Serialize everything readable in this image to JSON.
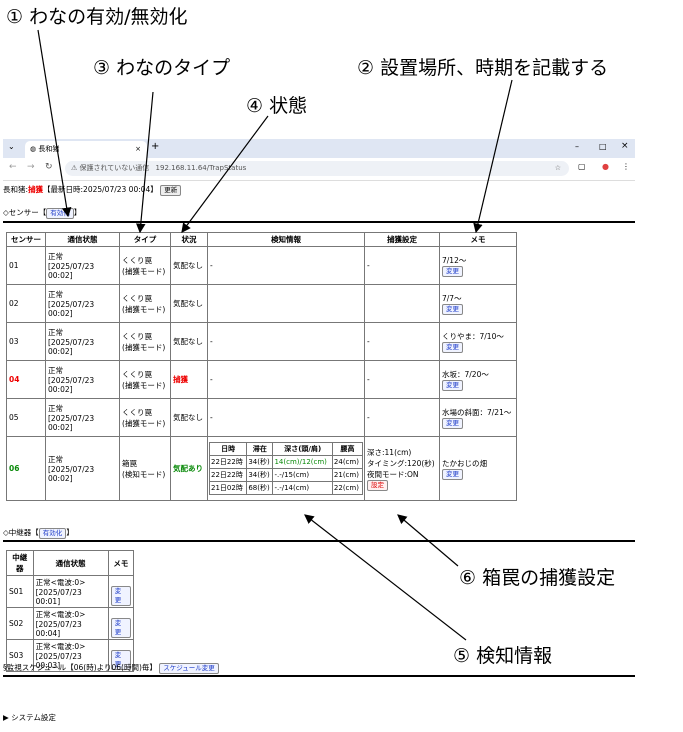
{
  "annotations": {
    "a1": "① わなの有効/無効化",
    "a2": "② 設置場所、時期を記載する",
    "a3": "③ わなのタイプ",
    "a4": "④ 状態",
    "a5": "⑤ 検知情報",
    "a6": "⑥ 箱罠の捕獲設定"
  },
  "browser": {
    "tab_title": "長和猪",
    "url": "192.168.11.64/TrapStatus",
    "not_secure": "保護されていない通信"
  },
  "header": {
    "prefix": "長和猪:",
    "status": "捕獲",
    "updated": "【最新日時:2025/07/23 00:04】",
    "update_button": "更新"
  },
  "sensor_section": {
    "label": "◇センサー【",
    "toggle": "有効化",
    "close": "】",
    "columns": [
      "センサー",
      "通信状態",
      "タイプ",
      "状況",
      "検知情報",
      "捕獲設定",
      "メモ"
    ],
    "rows": [
      {
        "id": "01",
        "comm1": "正常",
        "comm2": "[2025/07/23 00:02]",
        "type1": "くくり罠",
        "type2": "(捕獲モード)",
        "status": "気配なし",
        "detect": "-",
        "capture": "-",
        "memo": "7/12～",
        "btn": "変更"
      },
      {
        "id": "02",
        "comm1": "正常",
        "comm2": "[2025/07/23 00:02]",
        "type1": "くくり罠",
        "type2": "(捕獲モード)",
        "status": "気配なし",
        "detect": "-",
        "capture": "-",
        "memo": "7/7～",
        "btn": "変更"
      },
      {
        "id": "03",
        "comm1": "正常",
        "comm2": "[2025/07/23 00:02]",
        "type1": "くくり罠",
        "type2": "(捕獲モード)",
        "status": "気配なし",
        "detect": "-",
        "capture": "-",
        "memo": "くりやま：7/10～",
        "btn": "変更"
      },
      {
        "id": "04",
        "comm1": "正常",
        "comm2": "[2025/07/23 00:02]",
        "type1": "くくり罠",
        "type2": "(捕獲モード)",
        "status": "捕獲",
        "detect": "-",
        "capture": "-",
        "memo": "水坂：7/20～",
        "btn": "変更"
      },
      {
        "id": "05",
        "comm1": "正常",
        "comm2": "[2025/07/23 00:02]",
        "type1": "くくり罠",
        "type2": "(捕獲モード)",
        "status": "気配なし",
        "detect": "-",
        "capture": "-",
        "memo": "水場の斜面：7/21～",
        "btn": "変更"
      }
    ],
    "row06": {
      "id": "06",
      "comm1": "正常",
      "comm2": "[2025/07/23 00:02]",
      "type1": "箱罠",
      "type2": "(検知モード)",
      "status": "気配あり",
      "detect_cols": [
        "日時",
        "滞在",
        "深さ(頭/肩)",
        "腰高"
      ],
      "detect_rows": [
        [
          "22日22時",
          "34(秒)",
          "14(cm)/12(cm)",
          "24(cm)"
        ],
        [
          "22日22時",
          "34(秒)",
          "-.-/15(cm)",
          "21(cm)"
        ],
        [
          "21日02時",
          "68(秒)",
          "-.-/14(cm)",
          "22(cm)"
        ]
      ],
      "cap1": "深さ:11(cm)",
      "cap2": "タイミング:120(秒)",
      "cap3": "夜間モード:ON",
      "cap_btn": "設定",
      "memo": "たかおじの畑",
      "btn": "変更"
    }
  },
  "relay_section": {
    "label": "◇中継器【",
    "toggle": "有効化",
    "close": "】",
    "columns": [
      "中継器",
      "通信状態",
      "メモ"
    ],
    "rows": [
      {
        "id": "S01",
        "c1": "正常<電波:0>",
        "c2": "[2025/07/23 00:01]",
        "btn": "変更"
      },
      {
        "id": "S02",
        "c1": "正常<電波:0>",
        "c2": "[2025/07/23 00:04]",
        "btn": "変更"
      },
      {
        "id": "S03",
        "c1": "正常<電波:0>",
        "c2": "[2025/07/23 00:03]",
        "btn": "変更"
      }
    ]
  },
  "schedule": {
    "text": "§監視スケジュール【06(時)より06(時間)毎】",
    "button": "スケジュール変更"
  },
  "system": {
    "text": "▶ システム設定"
  }
}
